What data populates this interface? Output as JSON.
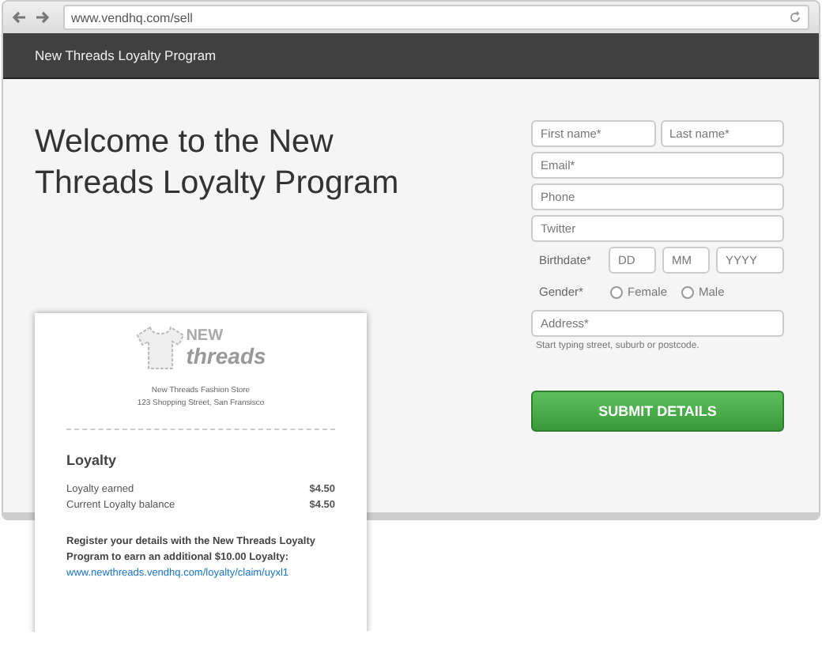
{
  "browser": {
    "url": "www.vendhq.com/sell"
  },
  "header": {
    "title": "New Threads Loyalty Program"
  },
  "heading": "Welcome to the New Threads Loyalty Program",
  "form": {
    "first_name": {
      "placeholder": "First name*"
    },
    "last_name": {
      "placeholder": "Last name*"
    },
    "email": {
      "placeholder": "Email*"
    },
    "phone": {
      "placeholder": "Phone"
    },
    "twitter": {
      "placeholder": "Twitter"
    },
    "birthdate": {
      "label": "Birthdate*",
      "fields": [
        {
          "placeholder": "DD"
        },
        {
          "placeholder": "MM"
        },
        {
          "placeholder": "YYYY"
        }
      ]
    },
    "gender": {
      "label": "Gender*",
      "options": [
        {
          "label": "Female",
          "selected": false
        },
        {
          "label": "Male",
          "selected": false
        }
      ]
    },
    "address": {
      "placeholder": "Address*",
      "hint": "Start typing street, suburb or postcode."
    },
    "submit": "SUBMIT DETAILS"
  },
  "receipt": {
    "logo_top": "NEW",
    "logo_bottom": "threads",
    "store": "New Threads Fashion Store",
    "address": "123 Shopping Street, San Fransisco",
    "section": "Loyalty",
    "lines": [
      {
        "label": "Loyalty earned",
        "amount": "$4.50"
      },
      {
        "label": "Current Loyalty balance",
        "amount": "$4.50"
      }
    ],
    "message": "Register your details with the New Threads Loyalty Program to earn an additional $10.00 Loyalty:",
    "link": "www.newthreads.vendhq.com/loyalty/claim/uyxl1"
  }
}
